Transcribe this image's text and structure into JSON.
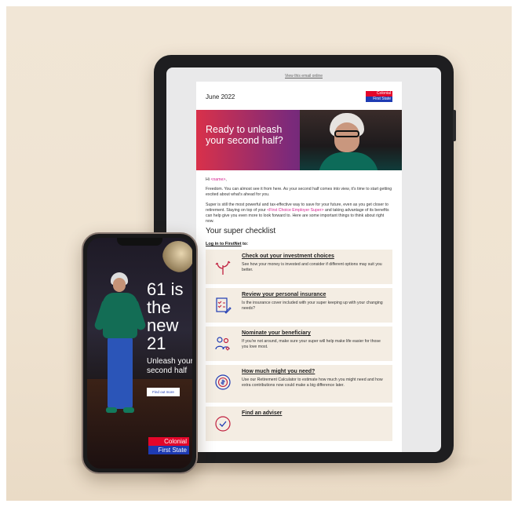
{
  "email": {
    "view_online": "View this email online",
    "date": "June 2022",
    "logo_line1": "Colonial",
    "logo_line2": "First State",
    "hero_title": "Ready to unleash your second half?",
    "greeting_prefix": "Hi ",
    "greeting_name": "<name>",
    "greeting_suffix": ",",
    "para1": "Freedom. You can almost see it from here. As your second half comes into view, it's time to start getting excited about what's ahead for you.",
    "para2_a": "Super is still the most powerful and tax-effective way to save for your future, even as you get closer to retirement. Staying on top of your ",
    "para2_link": "<First Choice Employer Super>",
    "para2_b": " and taking advantage of its benefits can help give you even more to look forward to. Here are some important things to think about right now.",
    "checklist_title": "Your super checklist",
    "login_prefix": "Log in to FirstNet",
    "login_suffix": " to:",
    "items": [
      {
        "title": "Check out your investment choices",
        "desc": "See how your money is invested and consider if different options may suit you better.",
        "icon": "growth-plant-icon"
      },
      {
        "title": "Review your personal insurance",
        "desc": "Is the insurance cover included with your super keeping up with your changing needs?",
        "icon": "document-checklist-icon"
      },
      {
        "title": "Nominate your beneficiary",
        "desc": "If you're not around, make sure your super will help make life easier for those you love most.",
        "icon": "family-icon"
      },
      {
        "title": "How much might you need?",
        "desc": "Use our Retirement Calculator to estimate how much you might need and how extra contributions now could make a big difference later.",
        "icon": "calculator-dollar-icon"
      },
      {
        "title": "Find an adviser",
        "desc": "",
        "icon": "adviser-check-icon"
      }
    ]
  },
  "phone": {
    "headline": "61 is the new 21",
    "subline": "Unleash your second half",
    "cta": "Find out more",
    "logo_line1": "Colonial",
    "logo_line2": "First State"
  },
  "colors": {
    "brand_red": "#e3062a",
    "brand_blue": "#1e3bb3",
    "link_pink": "#d6208f",
    "card_beige": "#f4ede3",
    "background": "#f1e6d6"
  }
}
